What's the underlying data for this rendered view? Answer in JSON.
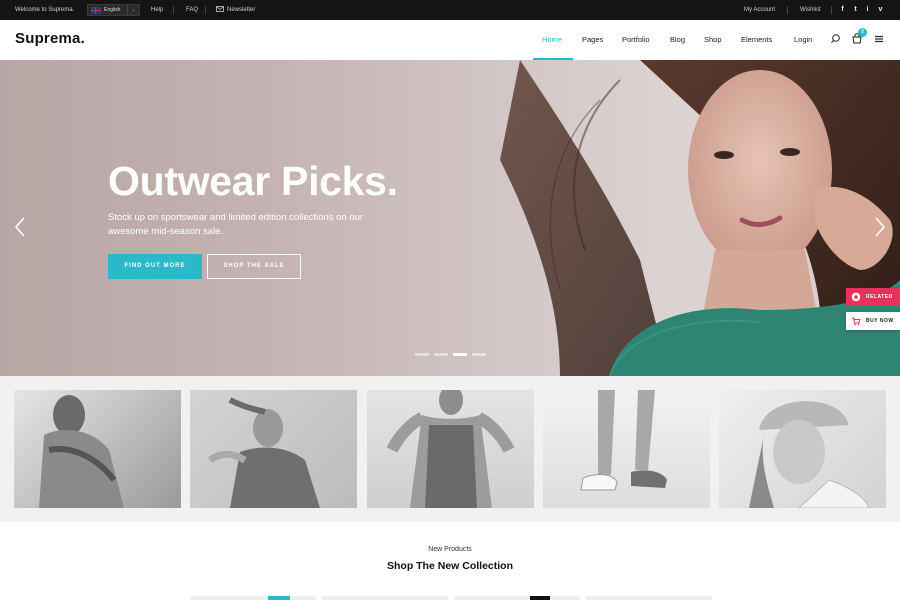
{
  "topbar": {
    "welcome": "Welcome to Suprema.",
    "language": "English",
    "help": "Help",
    "faq": "FAQ",
    "newsletter": "Newsletter",
    "my_account": "My Account",
    "wishlist": "Wishlist",
    "social": [
      "f",
      "t",
      "i",
      "v"
    ]
  },
  "nav": {
    "logo": "Suprema.",
    "items": [
      "Home",
      "Pages",
      "Portfolio",
      "Blog",
      "Shop",
      "Elements",
      "Login"
    ],
    "active": "Home",
    "cart_count": "0",
    "accent": "#2bb9c9"
  },
  "hero": {
    "title": "Outwear Picks.",
    "subtitle": "Stock up on sportswear and limited edition collections on our awesome mid-season sale.",
    "primary_button": "FIND OUT MORE",
    "secondary_button": "SHOP THE SALE",
    "slide_count": 4,
    "active_slide": 3
  },
  "side_tags": {
    "related": "RELATED",
    "buy_now": "BUY NOW",
    "related_color": "#e8325b"
  },
  "section": {
    "eyebrow": "New Products",
    "title": "Shop The New Collection"
  }
}
